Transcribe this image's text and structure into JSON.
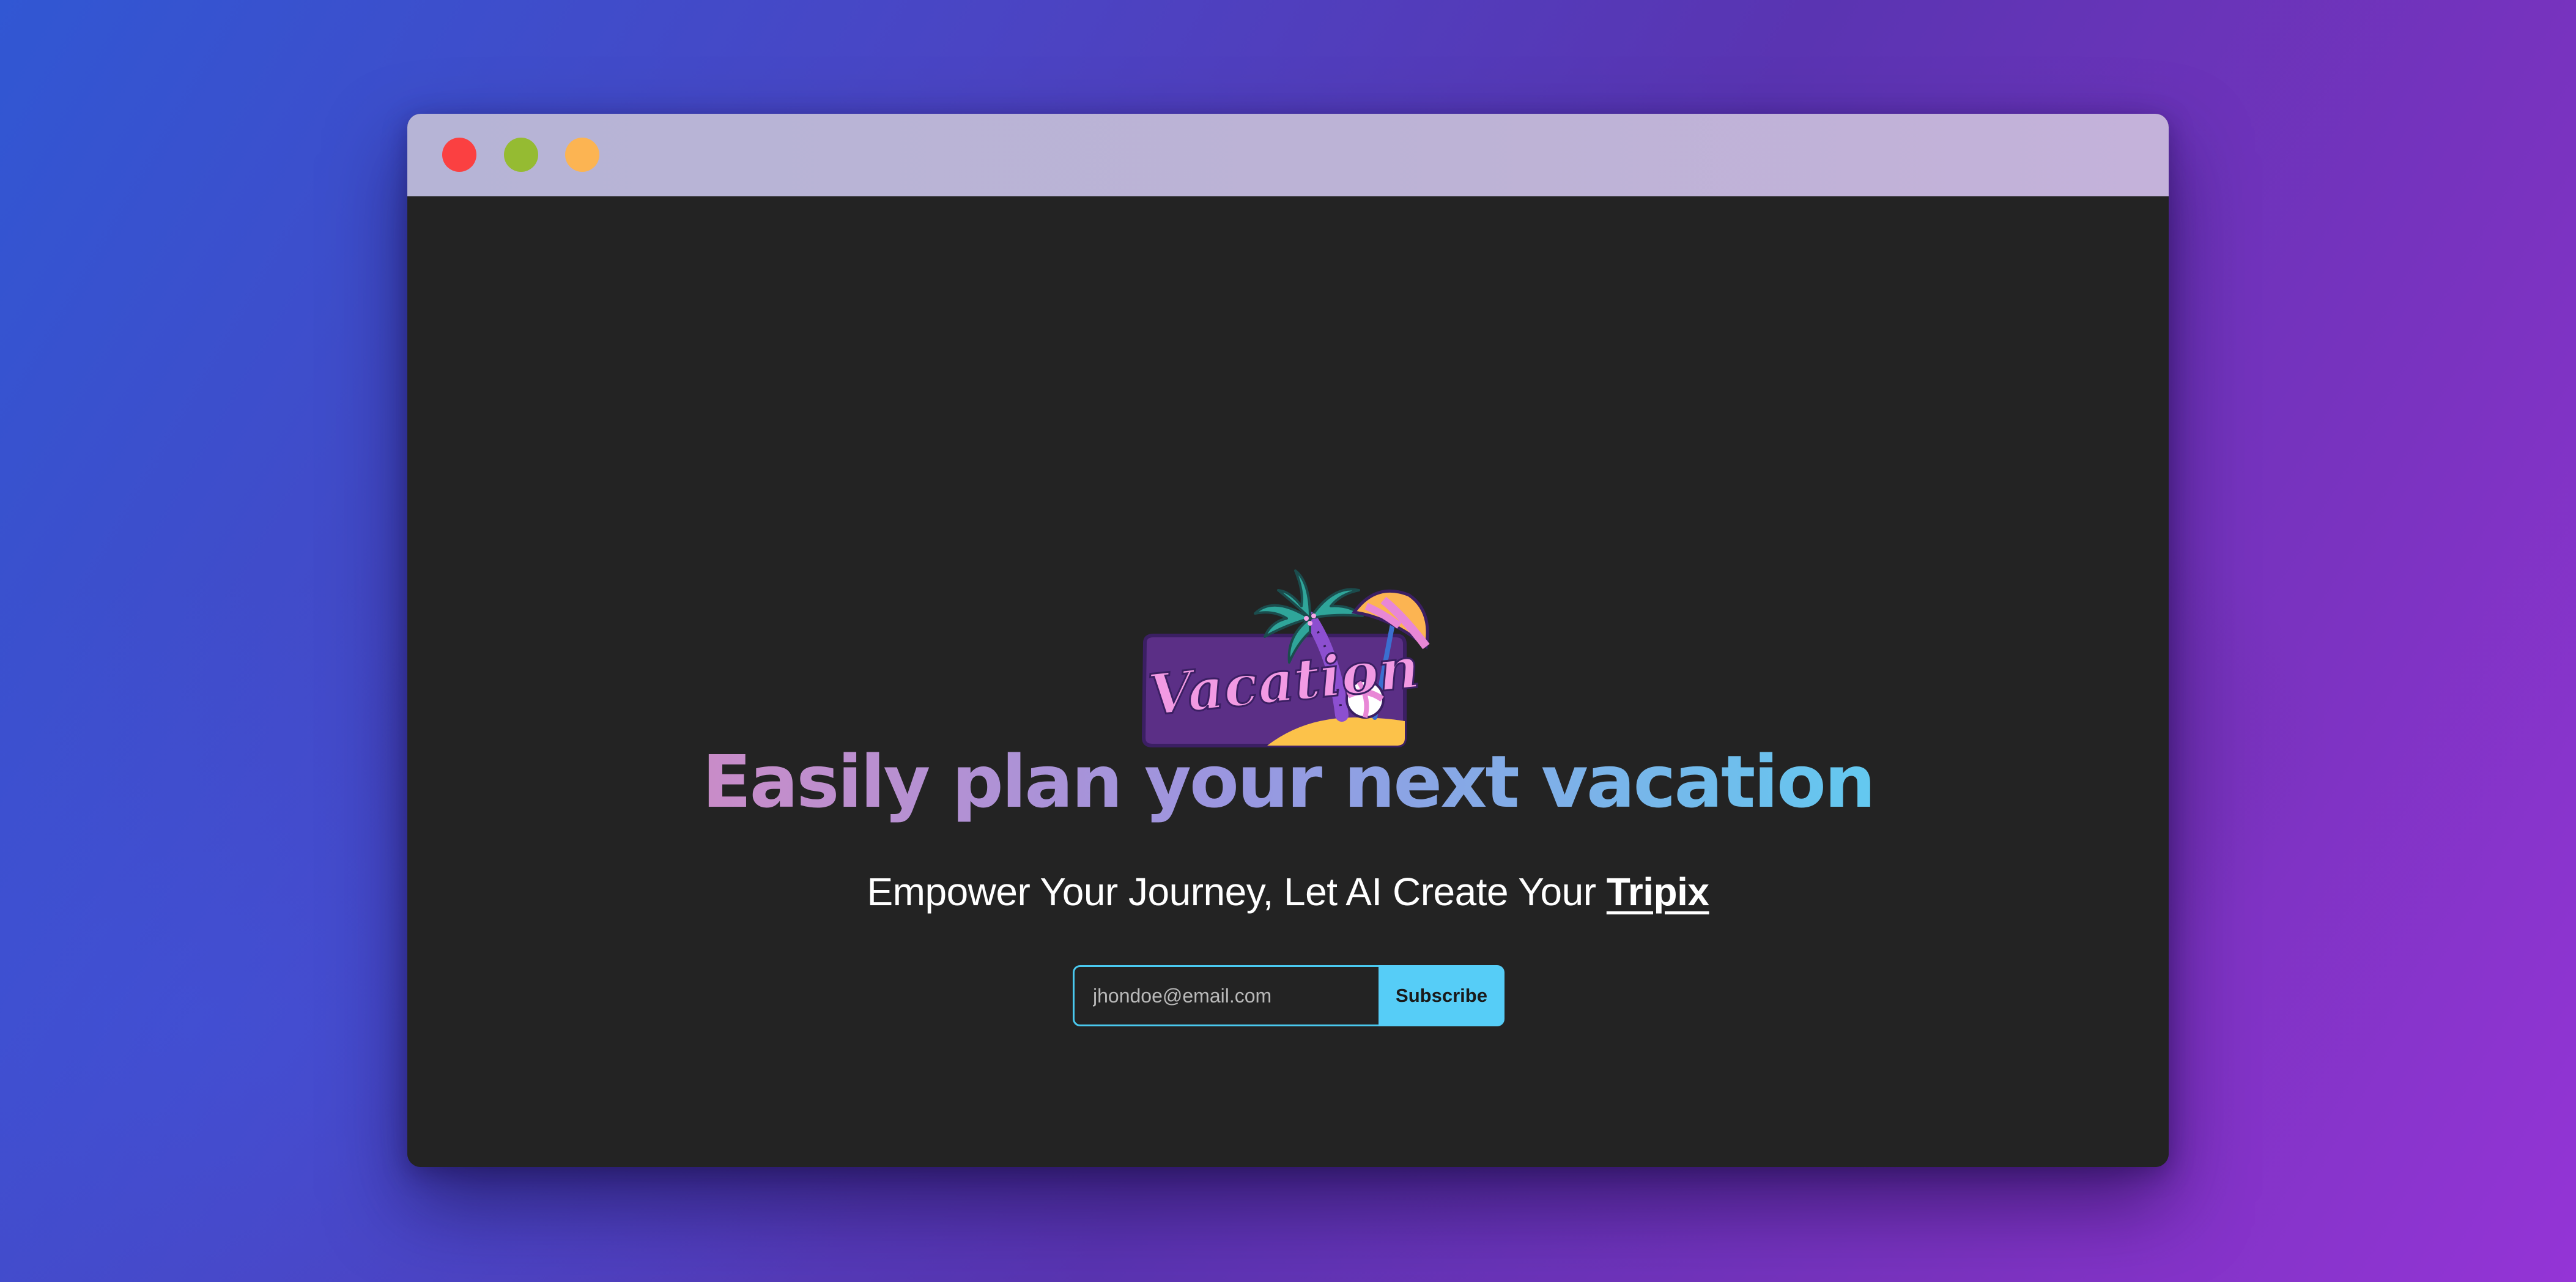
{
  "window": {
    "controls": [
      "close",
      "minimize",
      "zoom"
    ]
  },
  "hero": {
    "logo_text": "Vacation",
    "headline": "Easily plan your next vacation",
    "subline_prefix": "Empower Your Journey, Let AI Create Your ",
    "subline_brand": "Tripix"
  },
  "signup": {
    "email_placeholder": "jhondoe@email.com",
    "subscribe_label": "Subscribe"
  },
  "colors": {
    "page_bg_start": "#3157d3",
    "page_bg_end": "#9434d6",
    "titlebar": "#bdb3d6",
    "content_bg": "#232323",
    "accent": "#56cdf7",
    "close_dot": "#fb4041",
    "minimize_dot": "#95bb32",
    "zoom_dot": "#fcb452"
  }
}
